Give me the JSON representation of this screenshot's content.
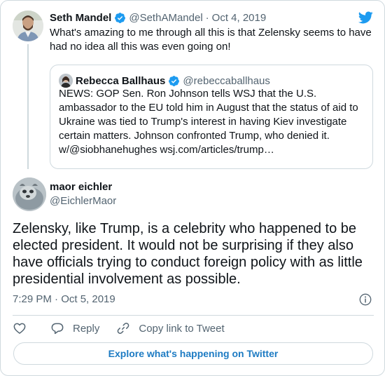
{
  "parent_tweet": {
    "name": "Seth Mandel",
    "handle": "@SethAMandel",
    "separator": "·",
    "date": "Oct 4, 2019",
    "text": "What's amazing to me through all this is that Zelensky seems to have had no idea all this was even going on!"
  },
  "quoted_tweet": {
    "name": "Rebecca Ballhaus",
    "handle": "@rebeccaballhaus",
    "text": "NEWS: GOP Sen. Ron Johnson tells WSJ that the U.S. ambassador to the EU told him in August that the status of aid to Ukraine was tied to Trump's interest in having Kiev investigate certain matters. Johnson confronted Trump, who denied it. w/@siobhanehughes wsj.com/articles/trump…"
  },
  "main_tweet": {
    "name": "maor eichler",
    "handle": "@EichlerMaor",
    "text": "Zelensky, like Trump, is a celebrity who happened to be elected president. It would not be surprising if they also have officials trying to conduct foreign policy with as little presidential involvement as possible.",
    "timestamp": "7:29 PM · Oct 5, 2019"
  },
  "actions": {
    "reply_label": "Reply",
    "copy_link_label": "Copy link to Tweet"
  },
  "explore_label": "Explore what's happening on Twitter",
  "colors": {
    "twitter_blue": "#1d9bf0",
    "text": "#0f1419",
    "secondary_text": "#536471",
    "border": "#cfd9de",
    "link": "#1d7bc3"
  },
  "icons": {
    "logo": "twitter-bird-icon",
    "verified": "verified-badge-icon",
    "info": "info-icon",
    "like": "heart-icon",
    "reply": "speech-bubble-icon",
    "copy_link": "link-icon"
  }
}
